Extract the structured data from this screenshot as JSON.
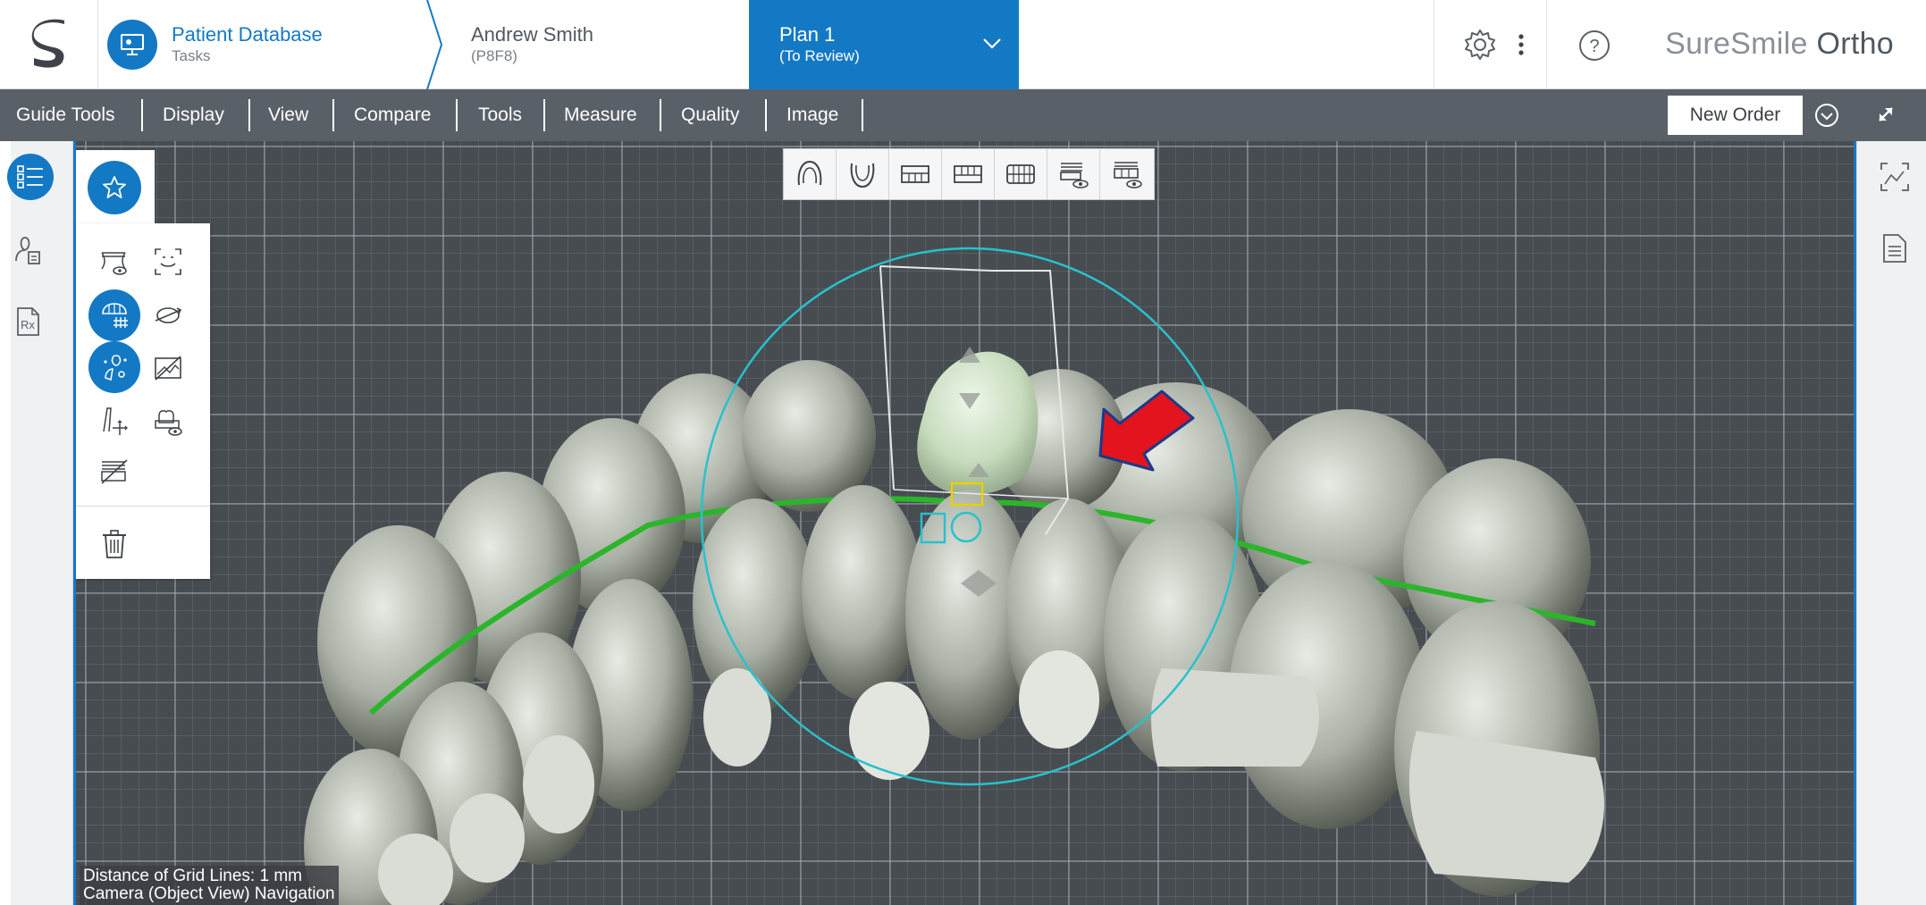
{
  "header": {
    "breadcrumb_patient": {
      "title": "Patient Database",
      "subtitle": "Tasks"
    },
    "breadcrumb_case": {
      "title": "Andrew Smith",
      "subtitle": "(P8F8)"
    },
    "breadcrumb_plan": {
      "title": "Plan 1",
      "subtitle": "(To Review)"
    },
    "brand_light": "SureSmile",
    "brand_bold": "Ortho"
  },
  "menu": {
    "items": [
      "Guide Tools",
      "Display",
      "View",
      "Compare",
      "Tools",
      "Measure",
      "Quality",
      "Image"
    ],
    "new_order_label": "New Order"
  },
  "viewport": {
    "info_line1": "Distance of Grid Lines: 1 mm",
    "info_line2": "Camera (Object View) Navigation"
  },
  "view_toolbar": {
    "icons": [
      "upper-arch-occlusal-icon",
      "lower-arch-occlusal-icon",
      "upper-front-view-icon",
      "lower-front-view-icon",
      "both-arches-front-icon",
      "gum-visibility-icon",
      "teeth-visibility-icon"
    ]
  },
  "tool_palette": {
    "active_tools": [
      "grid-overlay-icon",
      "tooth-move-icon"
    ]
  },
  "colors": {
    "accent": "#1479c5",
    "menubar": "#5a6068",
    "viewport_bg": "#474c51",
    "arrow": "#e3141d",
    "selected_tooth": "#cfe6c6"
  }
}
